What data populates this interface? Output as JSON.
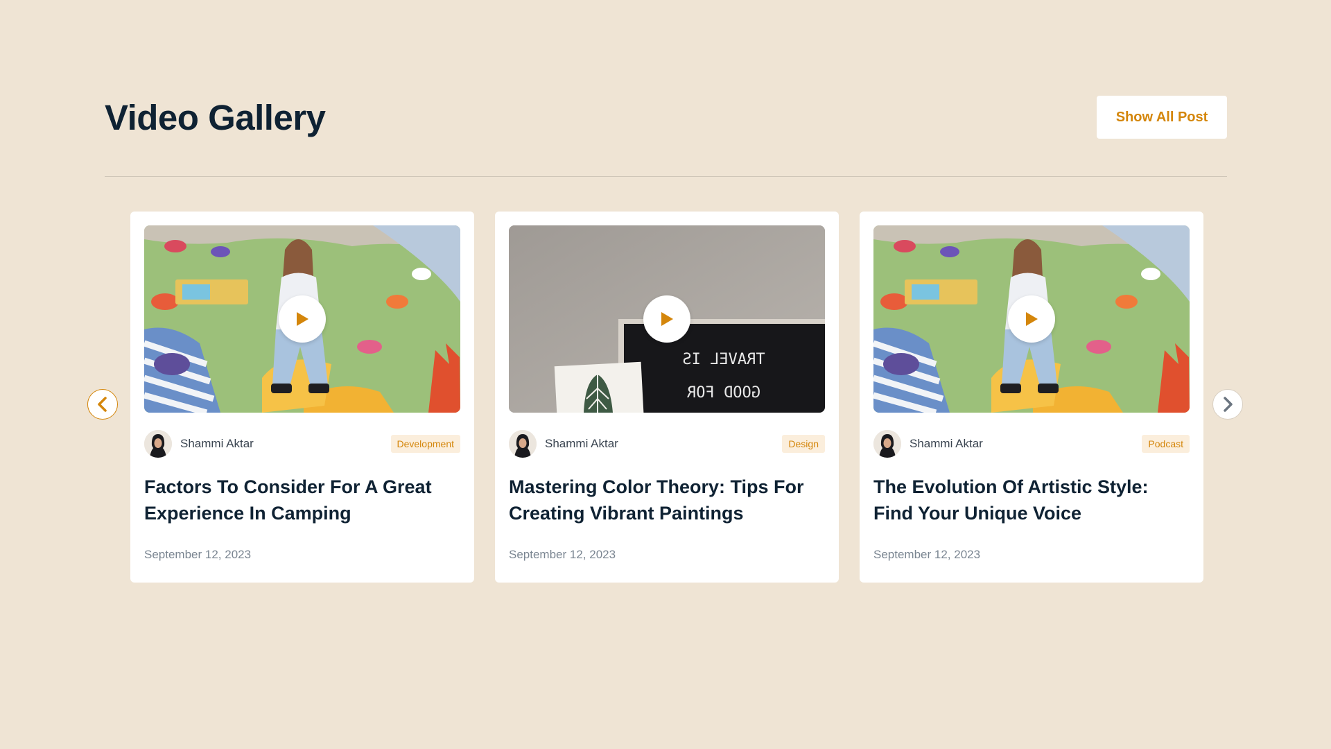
{
  "section": {
    "title": "Video Gallery",
    "show_all_label": "Show All Post"
  },
  "navigation": {
    "prev_icon": "chevron-left-icon",
    "next_icon": "chevron-right-icon"
  },
  "colors": {
    "background": "#EFE4D4",
    "accent": "#D4860B",
    "badge_bg": "#FBEEDC",
    "heading": "#0F2233"
  },
  "cards": [
    {
      "author": "Shammi Aktar",
      "category": "Development",
      "title": "Factors To Consider For A Great Experience In Camping",
      "date": "September 12, 2023"
    },
    {
      "author": "Shammi Aktar",
      "category": "Design",
      "title": "Mastering Color Theory: Tips For Creating Vibrant Paintings",
      "date": "September 12, 2023"
    },
    {
      "author": "Shammi Aktar",
      "category": "Podcast",
      "title": "The Evolution Of Artistic Style: Find Your Unique Voice",
      "date": "September 12, 2023"
    }
  ]
}
